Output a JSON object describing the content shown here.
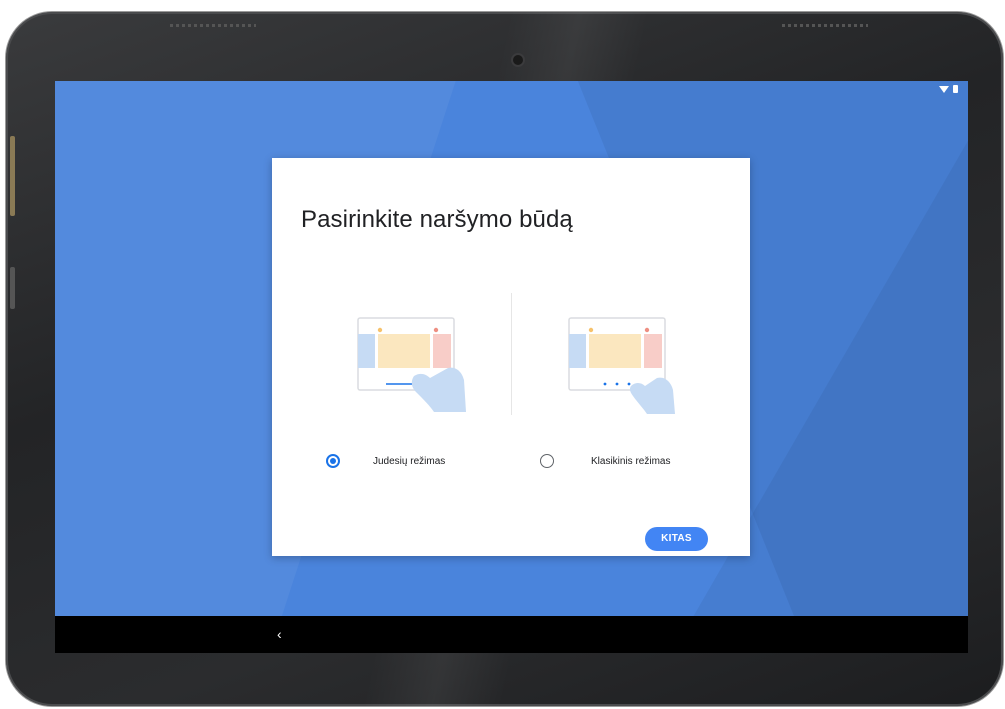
{
  "dialog": {
    "title": "Pasirinkite naršymo būdą",
    "options": [
      {
        "label": "Judesių režimas",
        "selected": true,
        "illustration": "gesture-navigation-illustration"
      },
      {
        "label": "Klasikinis režimas",
        "selected": false,
        "illustration": "three-button-navigation-illustration"
      }
    ],
    "next_button": "KITAS"
  },
  "status_bar": {
    "icons": [
      "wifi-icon",
      "battery-icon"
    ]
  },
  "nav_bar": {
    "icons": [
      "back-icon"
    ],
    "back_glyph": "‹"
  },
  "colors": {
    "background": "#4a84dc",
    "accent": "#1a73e8",
    "button": "#4285f4",
    "card": "#ffffff"
  }
}
